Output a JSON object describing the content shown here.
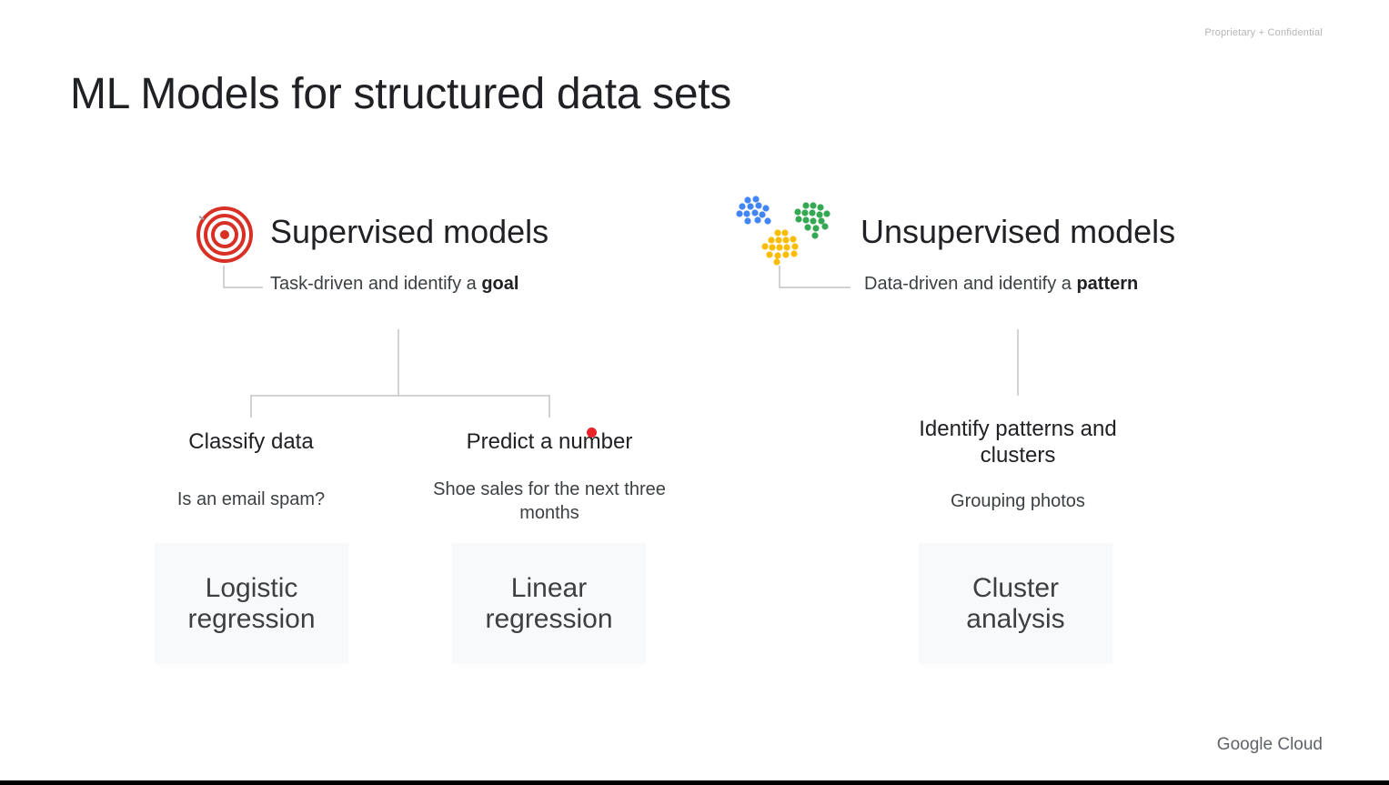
{
  "header": {
    "confidential": "Proprietary + Confidential",
    "title": "ML Models for structured data sets"
  },
  "supervised": {
    "heading": "Supervised models",
    "subtitle_prefix": "Task-driven and identify a ",
    "subtitle_bold": "goal",
    "icon": "target-icon",
    "branches": [
      {
        "title": "Classify data",
        "example": "Is an email spam?",
        "model": "Logistic regression"
      },
      {
        "title": "Predict a number",
        "example": "Shoe sales for the next three months",
        "model": "Linear regression"
      }
    ]
  },
  "unsupervised": {
    "heading": "Unsupervised models",
    "subtitle_prefix": "Data-driven and identify a ",
    "subtitle_bold": "pattern",
    "icon": "dot-clusters-icon",
    "branches": [
      {
        "title": "Identify patterns and clusters",
        "example": "Grouping photos",
        "model": "Cluster analysis"
      }
    ]
  },
  "footer": {
    "brand": "Google Cloud"
  },
  "colors": {
    "target_red": "#d93025",
    "cluster_blue": "#4285f4",
    "cluster_green": "#34a853",
    "cluster_yellow": "#fbbc04",
    "connector": "#bdbdbd",
    "card_bg": "#f8f9fa",
    "pointer_dot": "#e8232c"
  }
}
